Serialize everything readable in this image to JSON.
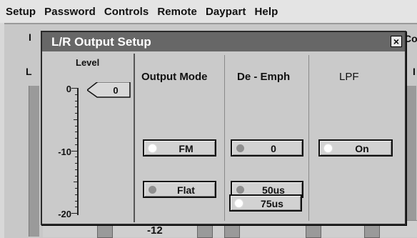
{
  "menu": [
    "Setup",
    "Password",
    "Controls",
    "Remote",
    "Daypart",
    "Help"
  ],
  "background": {
    "left_fragment_top": "I",
    "left_fragment_panel": "L",
    "right_fragment_top": "Co",
    "right_fragment_panel": "I",
    "bottom_value": "-12"
  },
  "dialog": {
    "title": "L/R Output Setup",
    "close_glyph": "×",
    "level": {
      "label": "Level",
      "value": "0",
      "ticks": [
        "0",
        "-10",
        "-20"
      ]
    },
    "columns": [
      {
        "header": "Output Mode",
        "options": [
          {
            "label": "FM",
            "active": true
          },
          {
            "label": "Flat",
            "active": false
          }
        ]
      },
      {
        "header": "De - Emph",
        "options": [
          {
            "label": "0",
            "active": false
          },
          {
            "label": "50us",
            "active": false
          },
          {
            "label": "75us",
            "active": true
          }
        ]
      },
      {
        "header": "LPF",
        "options": [
          {
            "label": "On",
            "active": true
          }
        ]
      }
    ]
  },
  "colors": {
    "title_bar": "#676767",
    "led_on": "#ffffff",
    "led_off": "#8f8f8f"
  }
}
